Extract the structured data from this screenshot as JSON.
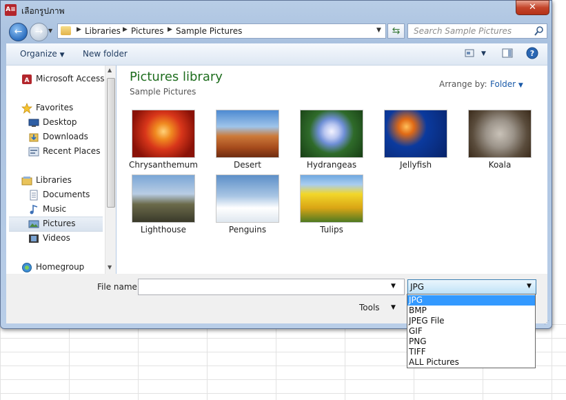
{
  "window": {
    "title": "เลือกรูปภาพ",
    "app_icon": "A≡",
    "close_label": "✕"
  },
  "nav": {
    "back_glyph": "←",
    "forward_glyph": "→",
    "breadcrumb": [
      "Libraries",
      "Pictures",
      "Sample Pictures"
    ],
    "search_placeholder": "Search Sample Pictures"
  },
  "toolbar": {
    "organize": "Organize",
    "new_folder": "New folder",
    "help_glyph": "?"
  },
  "sidebar": {
    "items": [
      {
        "label": "Microsoft Access",
        "icon": "access-icon"
      },
      {
        "label": "Favorites",
        "icon": "star-icon"
      },
      {
        "label": "Desktop",
        "icon": "desktop-icon"
      },
      {
        "label": "Downloads",
        "icon": "downloads-icon"
      },
      {
        "label": "Recent Places",
        "icon": "recent-places-icon"
      },
      {
        "label": "Libraries",
        "icon": "libraries-icon"
      },
      {
        "label": "Documents",
        "icon": "documents-icon"
      },
      {
        "label": "Music",
        "icon": "music-icon"
      },
      {
        "label": "Pictures",
        "icon": "pictures-icon"
      },
      {
        "label": "Videos",
        "icon": "videos-icon"
      },
      {
        "label": "Homegroup",
        "icon": "homegroup-icon"
      }
    ]
  },
  "main": {
    "library_title": "Pictures library",
    "library_subtitle": "Sample Pictures",
    "arrange_by_label": "Arrange by:",
    "arrange_by_value": "Folder",
    "pictures": [
      "Chrysanthemum",
      "Desert",
      "Hydrangeas",
      "Jellyfish",
      "Koala",
      "Lighthouse",
      "Penguins",
      "Tulips"
    ]
  },
  "footer": {
    "file_name_label": "File name:",
    "file_name_value": "",
    "file_type_selected": "JPG",
    "tools_label": "Tools"
  },
  "file_type_options": [
    "JPG",
    "BMP",
    "JPEG File",
    "GIF",
    "PNG",
    "TIFF",
    "ALL Pictures"
  ],
  "colors": {
    "title_green": "#1e6d1e",
    "link_blue": "#1a5aa8",
    "selection": "#3399ff",
    "close_red": "#c4452b"
  }
}
